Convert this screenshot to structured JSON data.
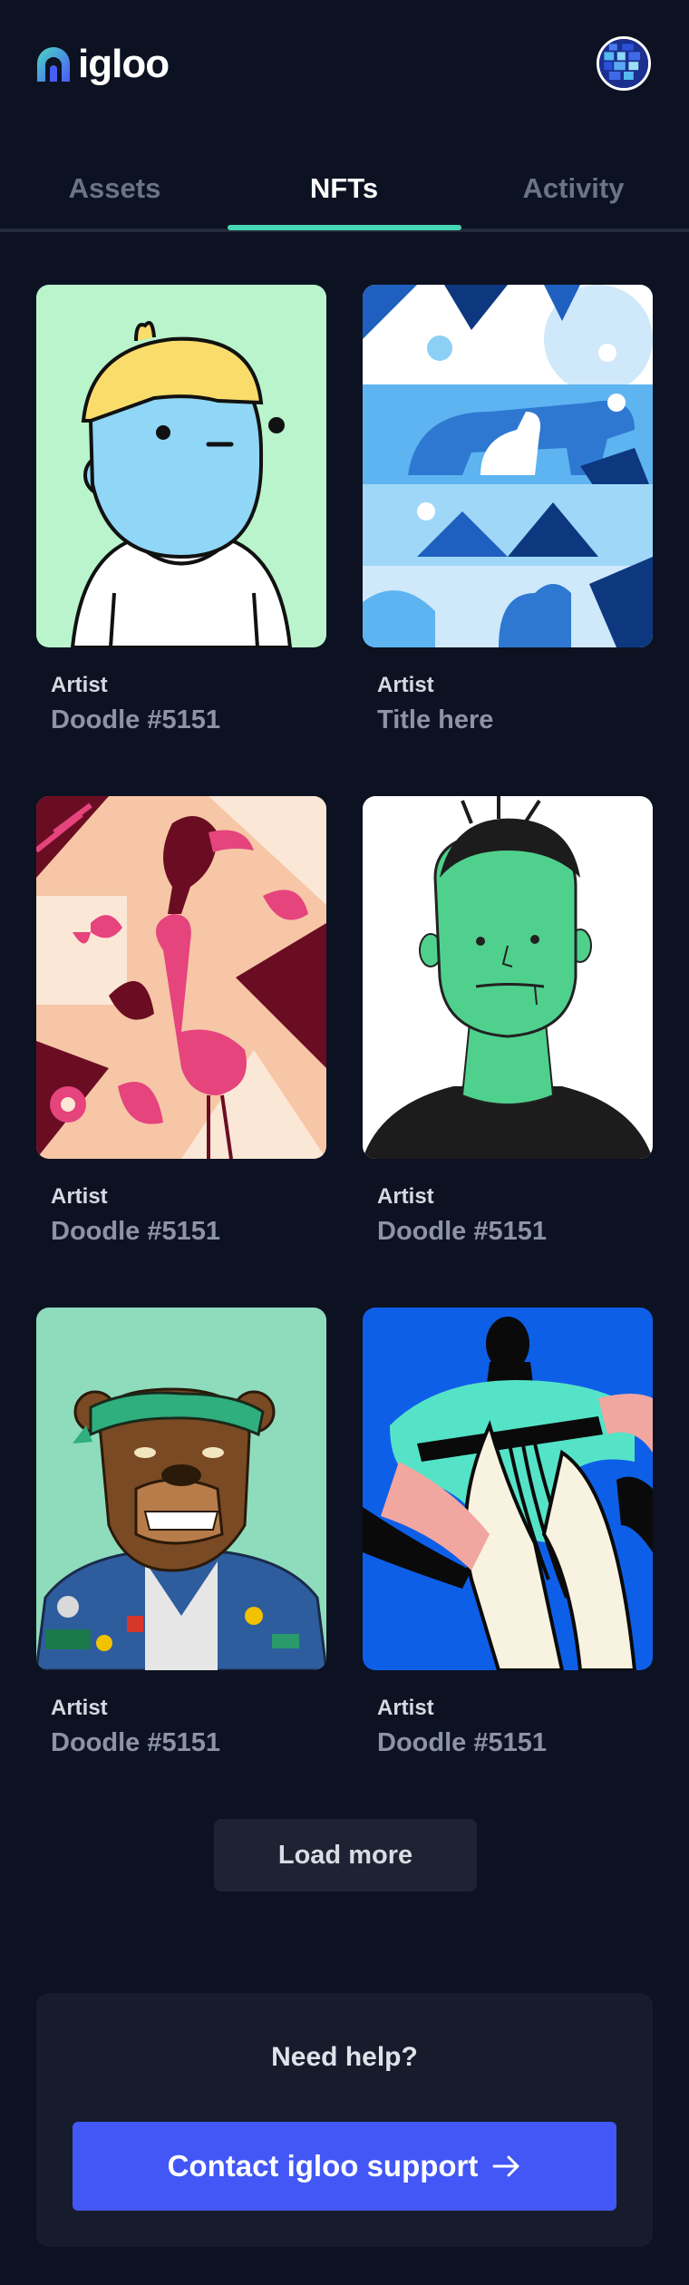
{
  "header": {
    "logo_text": "igloo",
    "logo_icon": "igloo-logo-icon",
    "avatar_icon": "pixel-globe-avatar"
  },
  "tabs": [
    {
      "label": "Assets",
      "active": false
    },
    {
      "label": "NFTs",
      "active": true
    },
    {
      "label": "Activity",
      "active": false
    }
  ],
  "nfts": [
    {
      "artist": "Artist",
      "title": "Doodle #5151",
      "art": "doodle-character"
    },
    {
      "artist": "Artist",
      "title": "Title here",
      "art": "polar-bear-pattern"
    },
    {
      "artist": "Artist",
      "title": "Doodle #5151",
      "art": "flamingo-pattern"
    },
    {
      "artist": "Artist",
      "title": "Doodle #5151",
      "art": "green-face-sketch"
    },
    {
      "artist": "Artist",
      "title": "Doodle #5151",
      "art": "bear-with-bandana"
    },
    {
      "artist": "Artist",
      "title": "Doodle #5151",
      "art": "abstract-figure"
    }
  ],
  "load_more": {
    "label": "Load more"
  },
  "help": {
    "title": "Need help?",
    "button_label": "Contact igloo support",
    "button_icon": "arrow-right-icon"
  },
  "colors": {
    "background": "#0d1222",
    "accent": "#47d6b3",
    "primary_button": "#4257f5"
  }
}
